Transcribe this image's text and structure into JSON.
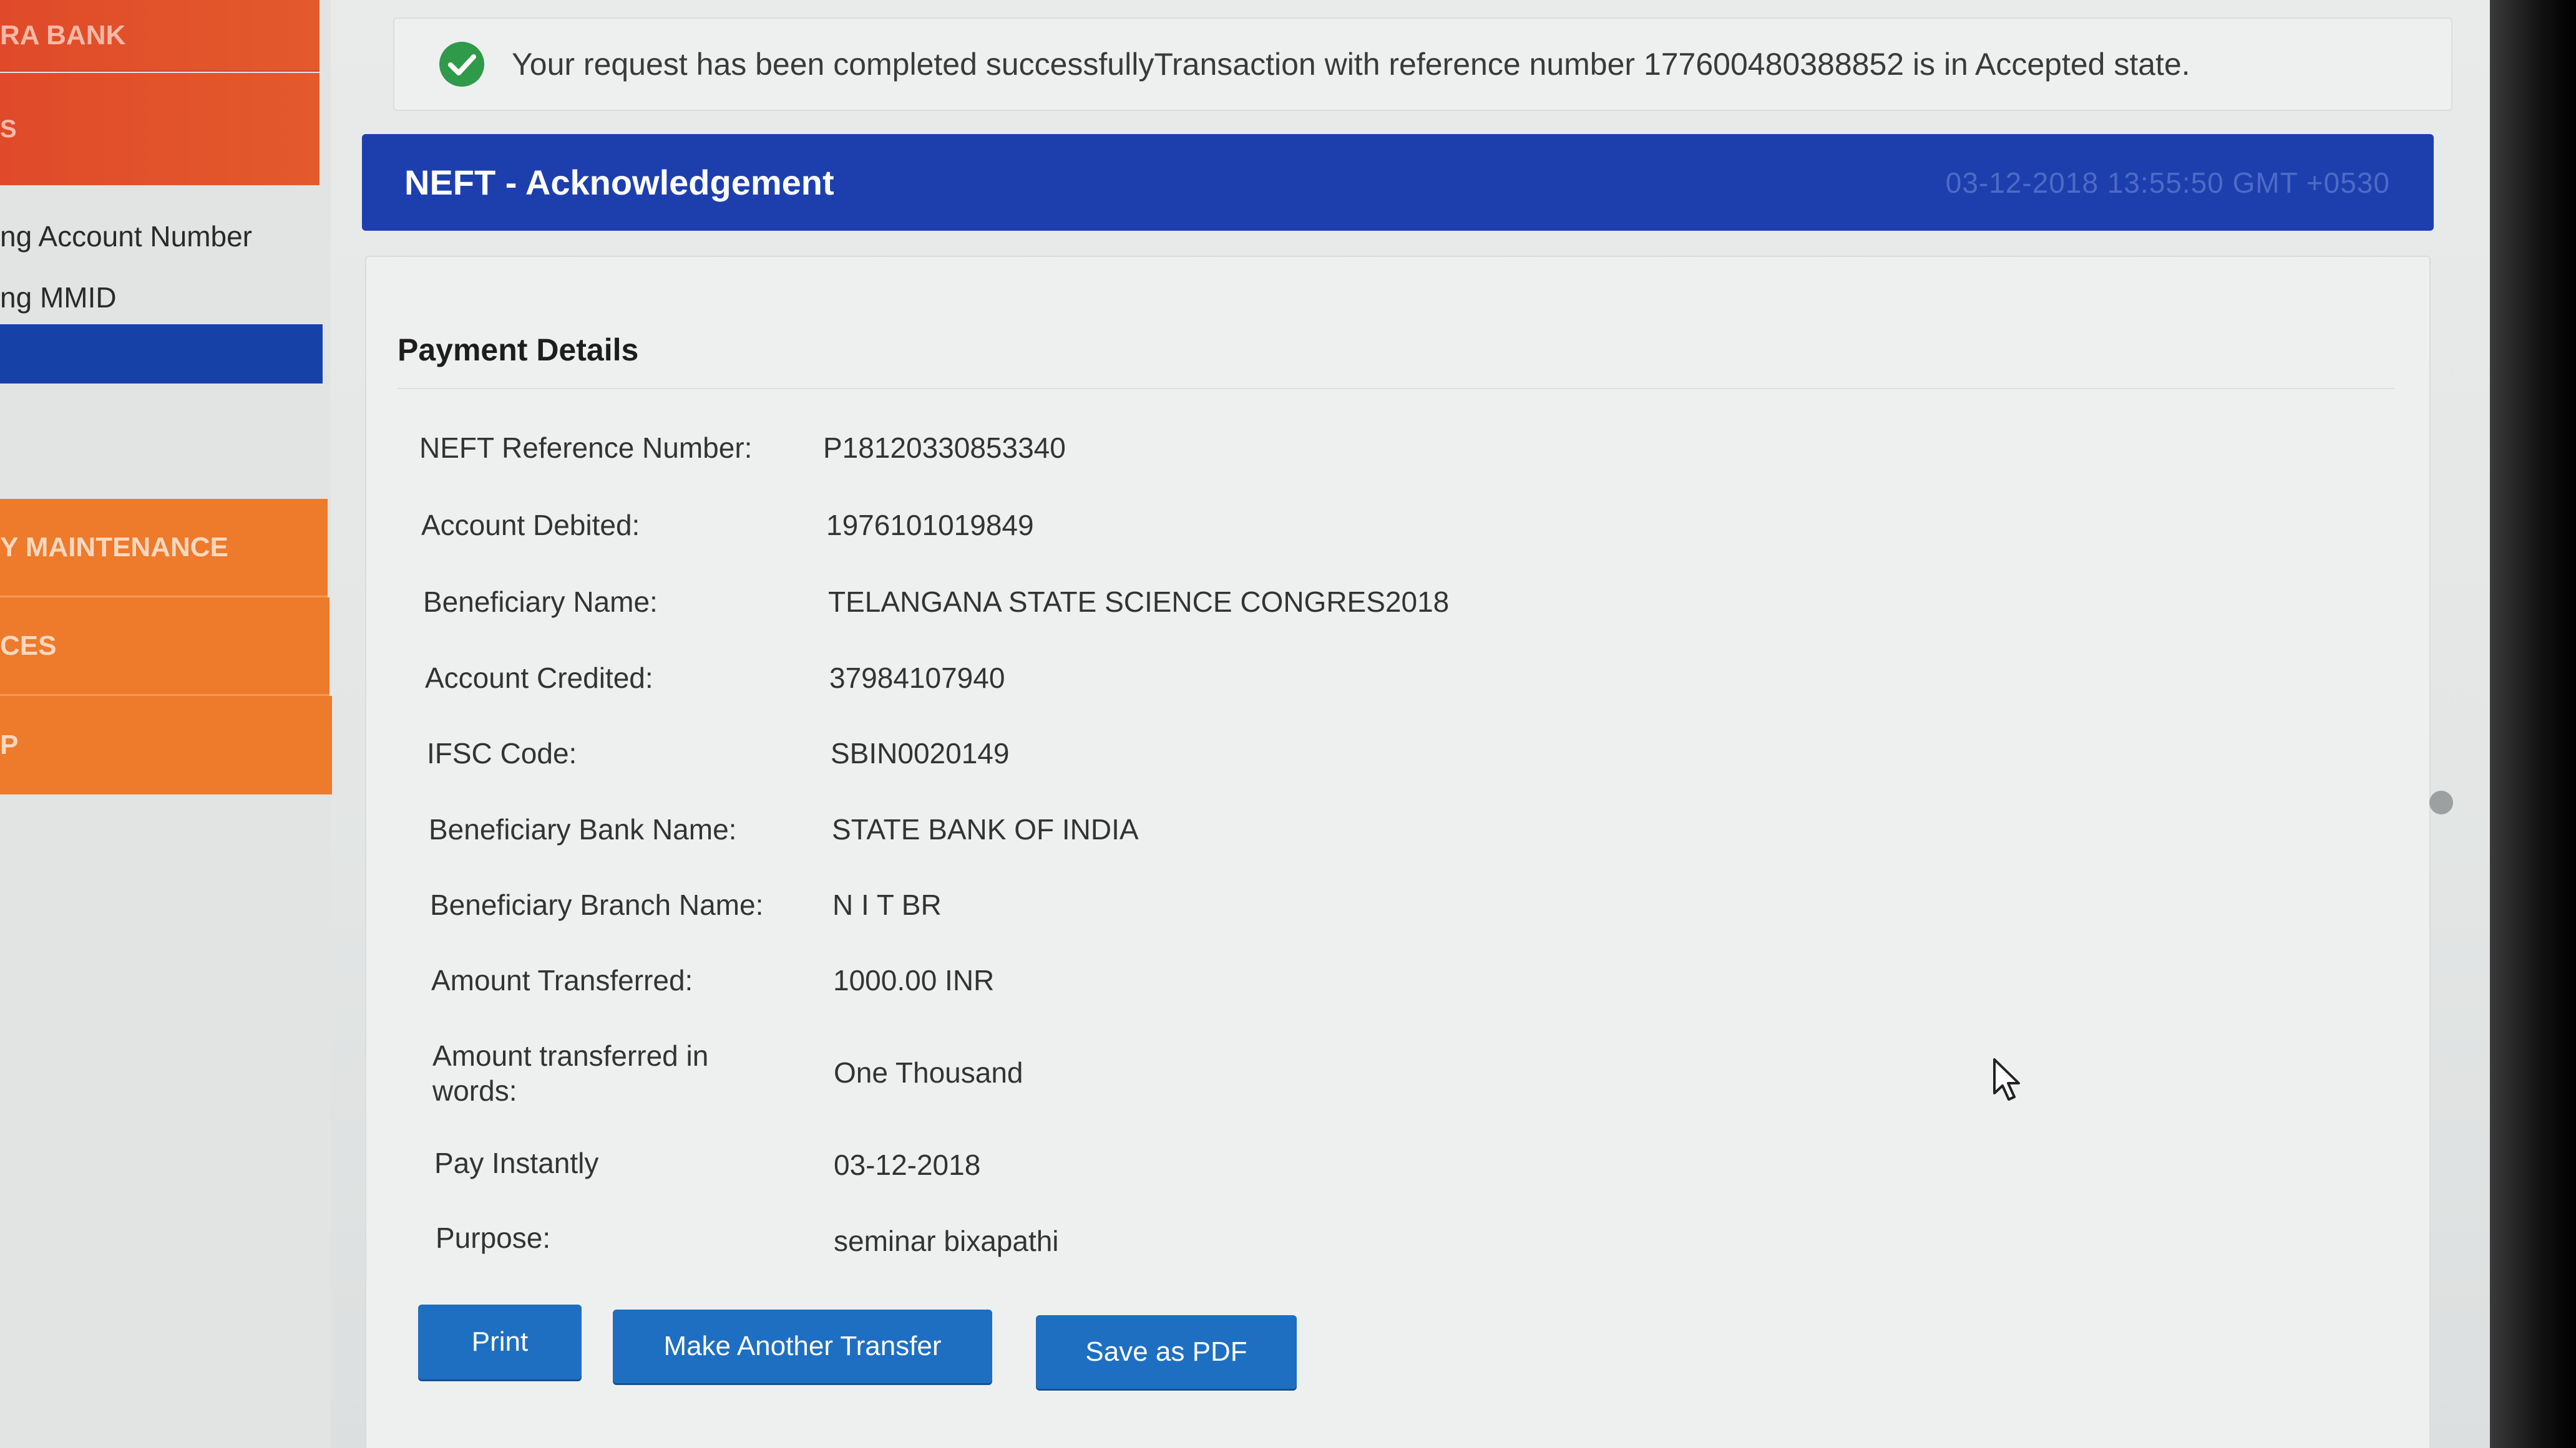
{
  "sidebar": {
    "bank_name": "RA BANK",
    "item_s": "S",
    "link_account_number": "ng Account Number",
    "link_mmid": "ng MMID",
    "item_maintenance": "Y MAINTENANCE",
    "item_ces": "CES",
    "item_p": "P"
  },
  "banner": {
    "message": "Your request has been completed successfullyTransaction with reference number 177600480388852 is in Accepted state.",
    "icon": "check-circle-icon"
  },
  "panel": {
    "title": "NEFT - Acknowledgement",
    "datetime": "03-12-2018 13:55:50 GMT +0530"
  },
  "payment": {
    "title": "Payment Details",
    "rows": [
      {
        "label": "NEFT Reference Number:",
        "value": "P18120330853340"
      },
      {
        "label": "Account Debited:",
        "value": "1976101019849"
      },
      {
        "label": "Beneficiary Name:",
        "value": "TELANGANA STATE SCIENCE CONGRES2018"
      },
      {
        "label": "Account Credited:",
        "value": "37984107940"
      },
      {
        "label": "IFSC Code:",
        "value": "SBIN0020149"
      },
      {
        "label": "Beneficiary Bank Name:",
        "value": "STATE BANK OF INDIA"
      },
      {
        "label": "Beneficiary Branch Name:",
        "value": "N I T BR"
      },
      {
        "label": "Amount Transferred:",
        "value": "1000.00 INR"
      },
      {
        "label": "Amount transferred in words:",
        "value": "One Thousand"
      },
      {
        "label": "Pay Instantly",
        "value": "03-12-2018"
      },
      {
        "label": "Purpose:",
        "value": "seminar bixapathi"
      }
    ],
    "alert_mark": "!"
  },
  "buttons": {
    "print": "Print",
    "make_another": "Make Another Transfer",
    "save_pdf": "Save as PDF"
  },
  "colors": {
    "header_blue": "#1d3fae",
    "button_blue": "#1e6fc2",
    "sidebar_red": "#e04a2a",
    "sidebar_orange": "#ee7a2b",
    "success_green": "#2e9a4a"
  }
}
